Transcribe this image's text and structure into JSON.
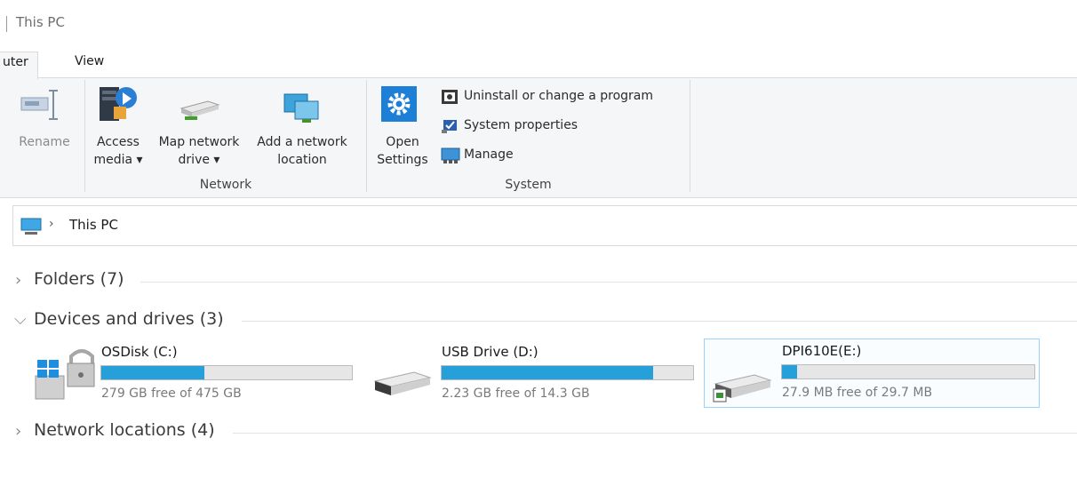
{
  "window": {
    "title": "This PC"
  },
  "tabs": [
    {
      "label": "uter"
    },
    {
      "label": "View"
    }
  ],
  "ribbon": {
    "rename_label": "Rename",
    "network_group": {
      "label": "Network",
      "access_media": [
        "Access",
        "media ▾"
      ],
      "map_network_drive": [
        "Map network",
        "drive ▾"
      ],
      "add_network_location": [
        "Add a network",
        "location"
      ]
    },
    "system_group": {
      "label": "System",
      "open_settings": [
        "Open",
        "Settings"
      ],
      "uninstall": "Uninstall or change a program",
      "system_properties": "System properties",
      "manage": "Manage"
    }
  },
  "address": {
    "path": "This PC"
  },
  "sections": {
    "folders": "Folders (7)",
    "devices": "Devices and drives (3)",
    "network": "Network locations (4)"
  },
  "drives": [
    {
      "name": "OSDisk (C:)",
      "free_text": "279 GB free of 475 GB",
      "used_fraction": 0.41,
      "icon": "os-disk-icon"
    },
    {
      "name": "USB Drive (D:)",
      "free_text": "2.23 GB free of 14.3 GB",
      "used_fraction": 0.84,
      "icon": "usb-drive-icon"
    },
    {
      "name": "DPI610E(E:)",
      "free_text": "27.9 MB free of 29.7 MB",
      "used_fraction": 0.06,
      "icon": "removable-drive-icon"
    }
  ],
  "colors": {
    "accent": "#26a0da",
    "selection_border": "#99d1ff"
  }
}
